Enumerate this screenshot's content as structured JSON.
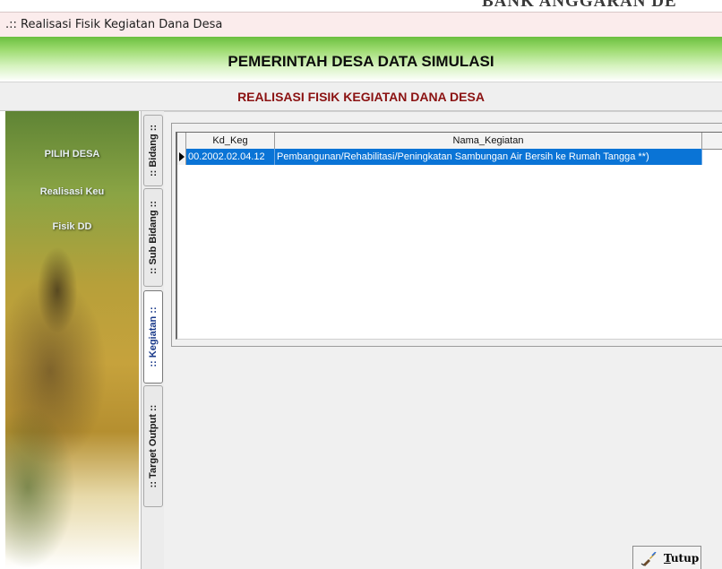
{
  "window": {
    "title": ".:: Realisasi Fisik Kegiatan Dana Desa",
    "background_text": "BANK ANGGARAN DE"
  },
  "header": {
    "title": "PEMERINTAH DESA DATA SIMULASI",
    "subtitle": "REALISASI FISIK KEGIATAN DANA DESA"
  },
  "sidebar": {
    "items": [
      {
        "label": "PILIH DESA"
      },
      {
        "label": "Realisasi Keu"
      },
      {
        "label": "Fisik DD"
      }
    ]
  },
  "tabs": [
    {
      "label": ":: Bidang ::",
      "active": false
    },
    {
      "label": ":: Sub Bidang ::",
      "active": false
    },
    {
      "label": ":: Kegiatan ::",
      "active": true
    },
    {
      "label": ":: Target Output ::",
      "active": false
    }
  ],
  "grid": {
    "columns": [
      "Kd_Keg",
      "Nama_Kegiatan"
    ],
    "rows": [
      {
        "kd_keg": "00.2002.02.04.12",
        "nama_kegiatan": "Pembangunan/Rehabilitasi/Peningkatan Sambungan Air Bersih ke Rumah Tangga **)",
        "selected": true
      }
    ]
  },
  "buttons": {
    "close_underlined": "T",
    "close_rest": "utup",
    "close_icon": "broom-icon"
  },
  "colors": {
    "header_green": "#6bbf3f",
    "subtitle_red": "#8b1212",
    "selection_blue": "#0a74d6",
    "active_tab_text": "#1a3a8a"
  }
}
